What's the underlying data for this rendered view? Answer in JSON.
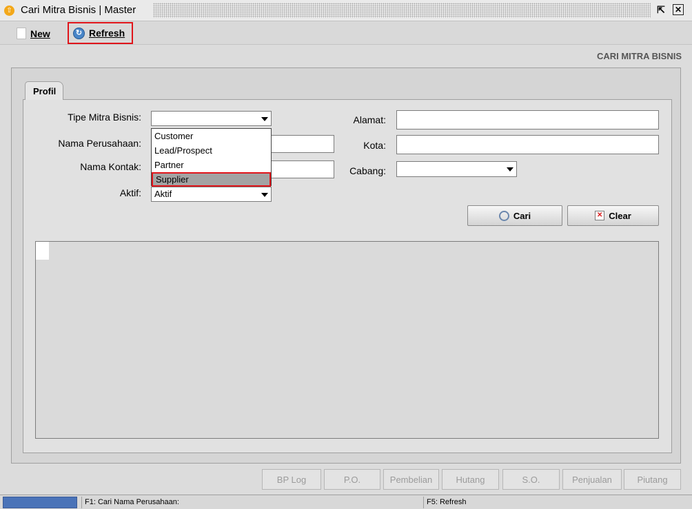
{
  "window": {
    "title": "Cari Mitra Bisnis | Master"
  },
  "toolbar": {
    "new_label": "New",
    "refresh_label": "Refresh"
  },
  "section_title": "CARI MITRA BISNIS",
  "tab": {
    "label": "Profil"
  },
  "form": {
    "tipe_label": "Tipe Mitra Bisnis:",
    "tipe_value": "",
    "nama_perusahaan_label": "Nama Perusahaan:",
    "nama_kontak_label": "Nama Kontak:",
    "aktif_label": "Aktif:",
    "aktif_value": "Aktif",
    "alamat_label": "Alamat:",
    "kota_label": "Kota:",
    "cabang_label": "Cabang:",
    "cabang_value": ""
  },
  "dropdown": {
    "options": [
      "Customer",
      "Lead/Prospect",
      "Partner",
      "Supplier"
    ],
    "highlighted": "Supplier"
  },
  "actions": {
    "cari_label": "Cari",
    "clear_label": "Clear"
  },
  "bottom_buttons": [
    "BP Log",
    "P.O.",
    "Pembelian",
    "Hutang",
    "S.O.",
    "Penjualan",
    "Piutang"
  ],
  "status": {
    "f1": "F1: Cari Nama Perusahaan:",
    "f5": "F5: Refresh"
  },
  "colors": {
    "highlight_border": "#e0141a",
    "selection_bg": "#a3a3a3",
    "status_accent": "#4a73b8"
  }
}
